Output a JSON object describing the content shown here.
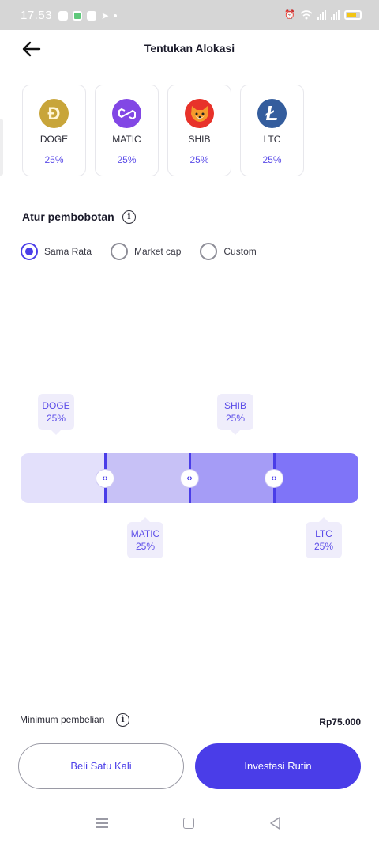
{
  "status_bar": {
    "time": "17.53"
  },
  "header": {
    "title": "Tentukan Alokasi"
  },
  "coins": [
    {
      "symbol": "DOGE",
      "percent": "25%",
      "icon": "dogecoin-logo-icon",
      "glyph": "Ð"
    },
    {
      "symbol": "MATIC",
      "percent": "25%",
      "icon": "polygon-logo-icon",
      "glyph": ""
    },
    {
      "symbol": "SHIB",
      "percent": "25%",
      "icon": "shiba-inu-logo-icon",
      "glyph": ""
    },
    {
      "symbol": "LTC",
      "percent": "25%",
      "icon": "litecoin-logo-icon",
      "glyph": "Ł"
    }
  ],
  "weighting": {
    "label": "Atur pembobotan",
    "info_icon": "info-icon",
    "options": [
      {
        "label": "Sama Rata",
        "selected": true
      },
      {
        "label": "Market cap",
        "selected": false
      },
      {
        "label": "Custom",
        "selected": false
      }
    ]
  },
  "allocation_bar": {
    "segments": [
      {
        "symbol": "DOGE",
        "percent": "25%",
        "share": 0.25,
        "color": "#e3e0fb"
      },
      {
        "symbol": "MATIC",
        "percent": "25%",
        "share": 0.25,
        "color": "#c7c1f6"
      },
      {
        "symbol": "SHIB",
        "percent": "25%",
        "share": 0.25,
        "color": "#a59cf6"
      },
      {
        "symbol": "LTC",
        "percent": "25%",
        "share": 0.25,
        "color": "#7f74f8"
      }
    ],
    "handle_glyph": "‹›"
  },
  "footer": {
    "min_label": "Minimum pembelian",
    "min_value": "Rp75.000",
    "btn_once": "Beli Satu Kali",
    "btn_recurring": "Investasi Rutin"
  },
  "colors": {
    "accent": "#4a3de8",
    "accent_light": "#efedfb"
  }
}
